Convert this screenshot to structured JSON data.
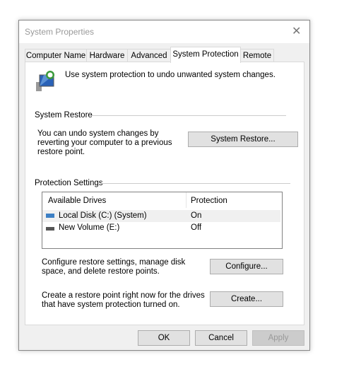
{
  "window": {
    "title": "System Properties"
  },
  "tabs": [
    {
      "label": "Computer Name"
    },
    {
      "label": "Hardware"
    },
    {
      "label": "Advanced"
    },
    {
      "label": "System Protection",
      "active": true
    },
    {
      "label": "Remote"
    }
  ],
  "intro": "Use system protection to undo unwanted system changes.",
  "restore": {
    "heading": "System Restore",
    "text": "You can undo system changes by reverting your computer to a previous restore point.",
    "button": "System Restore..."
  },
  "protection": {
    "heading": "Protection Settings",
    "columns": [
      "Available Drives",
      "Protection"
    ],
    "drives": [
      {
        "name": "Local Disk (C:) (System)",
        "status": "On",
        "icon": "system-drive-icon"
      },
      {
        "name": "New Volume (E:)",
        "status": "Off",
        "icon": "drive-icon"
      }
    ],
    "configure_text": "Configure restore settings, manage disk space, and delete restore points.",
    "configure_button": "Configure...",
    "create_text": "Create a restore point right now for the drives that have system protection turned on.",
    "create_button": "Create..."
  },
  "footer": {
    "ok": "OK",
    "cancel": "Cancel",
    "apply": "Apply"
  }
}
